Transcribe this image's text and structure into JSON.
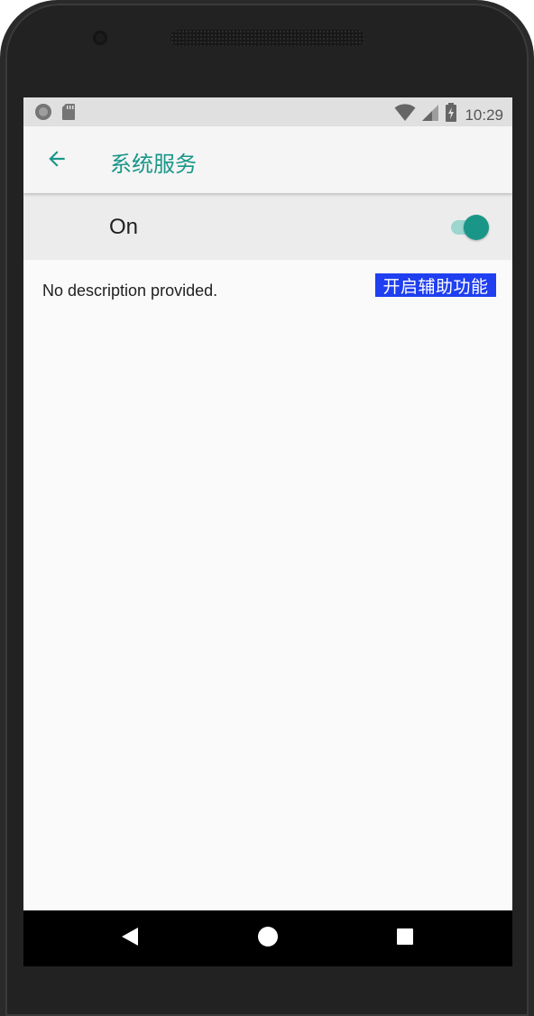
{
  "status_bar": {
    "time": "10:29",
    "left_icons": [
      "circle-notification-icon",
      "sd-card-icon"
    ],
    "right_icons": [
      "wifi-icon",
      "cell-signal-icon",
      "battery-charging-icon"
    ]
  },
  "toolbar": {
    "back_icon": "arrow-back-icon",
    "title": "系统服务"
  },
  "switch_bar": {
    "label": "On",
    "checked": true
  },
  "content": {
    "description": "No description provided.",
    "overlay_badge": "开启辅助功能"
  },
  "navigation_bar": {
    "buttons": [
      "back-triangle-icon",
      "home-circle-icon",
      "recents-square-icon"
    ]
  },
  "colors": {
    "accent": "#1a9688",
    "toggle_track": "#9cd6cf",
    "badge": "#1f3ff0"
  }
}
